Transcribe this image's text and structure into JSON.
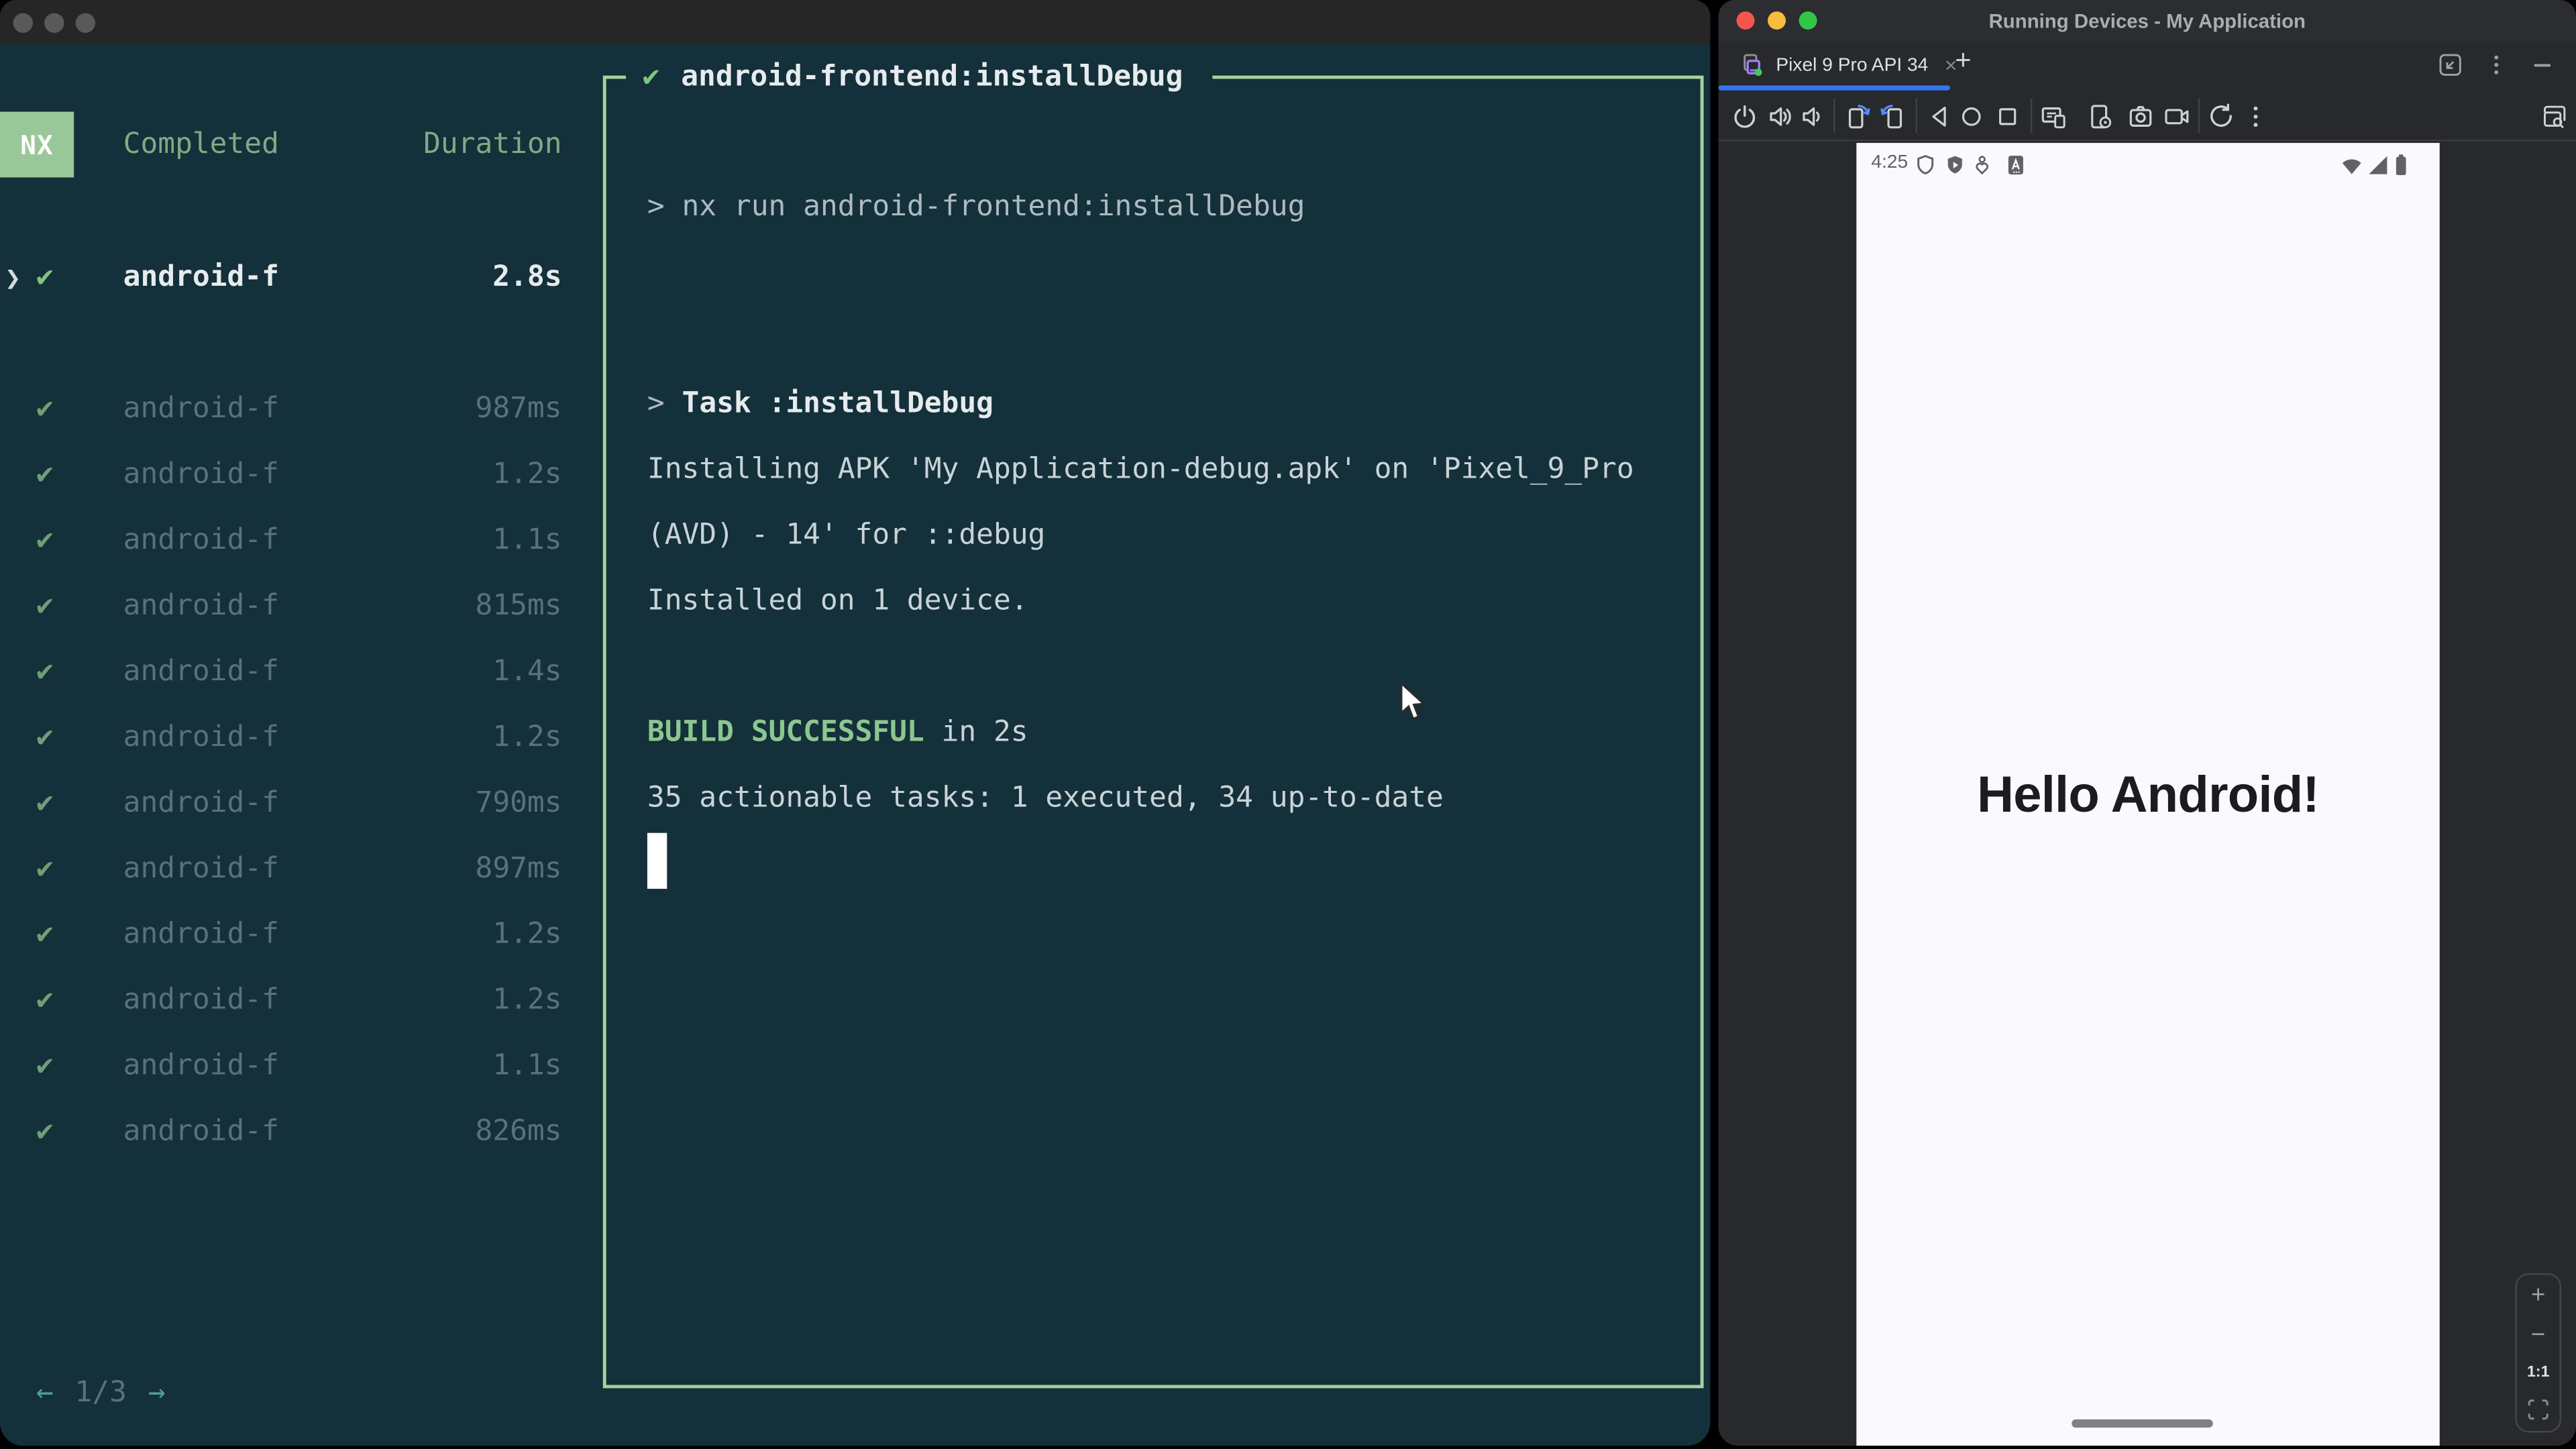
{
  "colors": {
    "terminal_bg": "#14303a",
    "terminal_titlebar": "#262626",
    "border_green": "#a5d19e",
    "badge_green": "#99c799",
    "header_green": "#7dab85",
    "check_green": "#7ec583",
    "dim_check_green": "#6f9f78",
    "bright_text": "#e6ebed",
    "dim_text": "#5b7079",
    "output_text": "#c9d3d7",
    "output_dim": "#aebabf",
    "success_green": "#8cc690",
    "pager_teal": "#4f9ba0",
    "studio_bg": "#27292c",
    "studio_titlebar": "#2b2d30",
    "panel_bg": "#28292c",
    "tab_underline_blue": "#3574f0",
    "traffic_red": "#f4564d",
    "traffic_yellow": "#f6bd3e",
    "traffic_green": "#33c748",
    "phone_screen_bg": "#faf9fe",
    "phone_text": "#1d1b20",
    "status_icon_gray": "#5f6368"
  },
  "terminal": {
    "titlebar": {
      "window_controls": [
        "close",
        "minimize",
        "zoom"
      ]
    },
    "tasks_panel": {
      "logo": "NX",
      "columns": {
        "completed": "Completed",
        "duration": "Duration"
      },
      "check_glyph": "✔",
      "selected": {
        "chevron": "❯",
        "check": "✔",
        "name": "android-f",
        "duration": "2.8s"
      },
      "tasks": [
        {
          "name": "android-f",
          "duration": "987ms"
        },
        {
          "name": "android-f",
          "duration": "1.2s"
        },
        {
          "name": "android-f",
          "duration": "1.1s"
        },
        {
          "name": "android-f",
          "duration": "815ms"
        },
        {
          "name": "android-f",
          "duration": "1.4s"
        },
        {
          "name": "android-f",
          "duration": "1.2s"
        },
        {
          "name": "android-f",
          "duration": "790ms"
        },
        {
          "name": "android-f",
          "duration": "897ms"
        },
        {
          "name": "android-f",
          "duration": "1.2s"
        },
        {
          "name": "android-f",
          "duration": "1.2s"
        },
        {
          "name": "android-f",
          "duration": "1.1s"
        },
        {
          "name": "android-f",
          "duration": "826ms"
        }
      ],
      "pagination": {
        "prev": "←",
        "current": "1/3",
        "next": "→"
      }
    },
    "output_panel": {
      "check": "✔",
      "title": "android-frontend:installDebug",
      "lines": [
        {
          "parts": [
            {
              "t": "> nx run android-frontend:installDebug",
              "s": "dim"
            }
          ]
        },
        {
          "parts": []
        },
        {
          "parts": []
        },
        {
          "parts": [
            {
              "t": "> ",
              "s": "dim"
            },
            {
              "t": "Task :installDebug",
              "s": "bold"
            }
          ]
        },
        {
          "parts": [
            {
              "t": "Installing APK 'My Application-debug.apk' on 'Pixel_9_Pro",
              "s": "normal"
            }
          ]
        },
        {
          "parts": [
            {
              "t": "(AVD) - 14' for ::debug",
              "s": "normal"
            }
          ]
        },
        {
          "parts": [
            {
              "t": "Installed on 1 device.",
              "s": "normal"
            }
          ]
        },
        {
          "parts": []
        },
        {
          "parts": [
            {
              "t": "BUILD SUCCESSFUL",
              "s": "success"
            },
            {
              "t": " in 2s",
              "s": "normal"
            }
          ]
        },
        {
          "parts": [
            {
              "t": "35 actionable tasks: 1 executed, 34 up-to-date",
              "s": "normal"
            }
          ]
        },
        {
          "cursor": true,
          "parts": []
        }
      ]
    }
  },
  "studio": {
    "title": "Running Devices - My Application",
    "tab": {
      "label": "Pixel 9 Pro API 34",
      "close_glyph": "×",
      "add_glyph": "+",
      "icon": "phone-device-icon"
    },
    "tabbar_right_icons": [
      "float-window-icon",
      "more-vertical-icon",
      "hide-icon"
    ],
    "toolbar_icons": [
      "power",
      "volume-up",
      "volume-down",
      "rotate-left",
      "rotate-right",
      "back",
      "home",
      "overview",
      "snapshots",
      "device-settings",
      "take-screenshot",
      "record-screen",
      "reset",
      "more-options",
      "zoom-and-pan"
    ],
    "device": {
      "status_bar": {
        "time": "4:25",
        "left_icons": [
          "shield",
          "shield-play",
          "assistant",
          "a-box"
        ],
        "right_icons": [
          "wifi",
          "cellular",
          "battery"
        ]
      },
      "content_text": "Hello Android!",
      "zoom_controls": {
        "zoom_in": "+",
        "zoom_out": "−",
        "actual_size": "1:1",
        "fit": "fit-screen-icon"
      }
    }
  }
}
